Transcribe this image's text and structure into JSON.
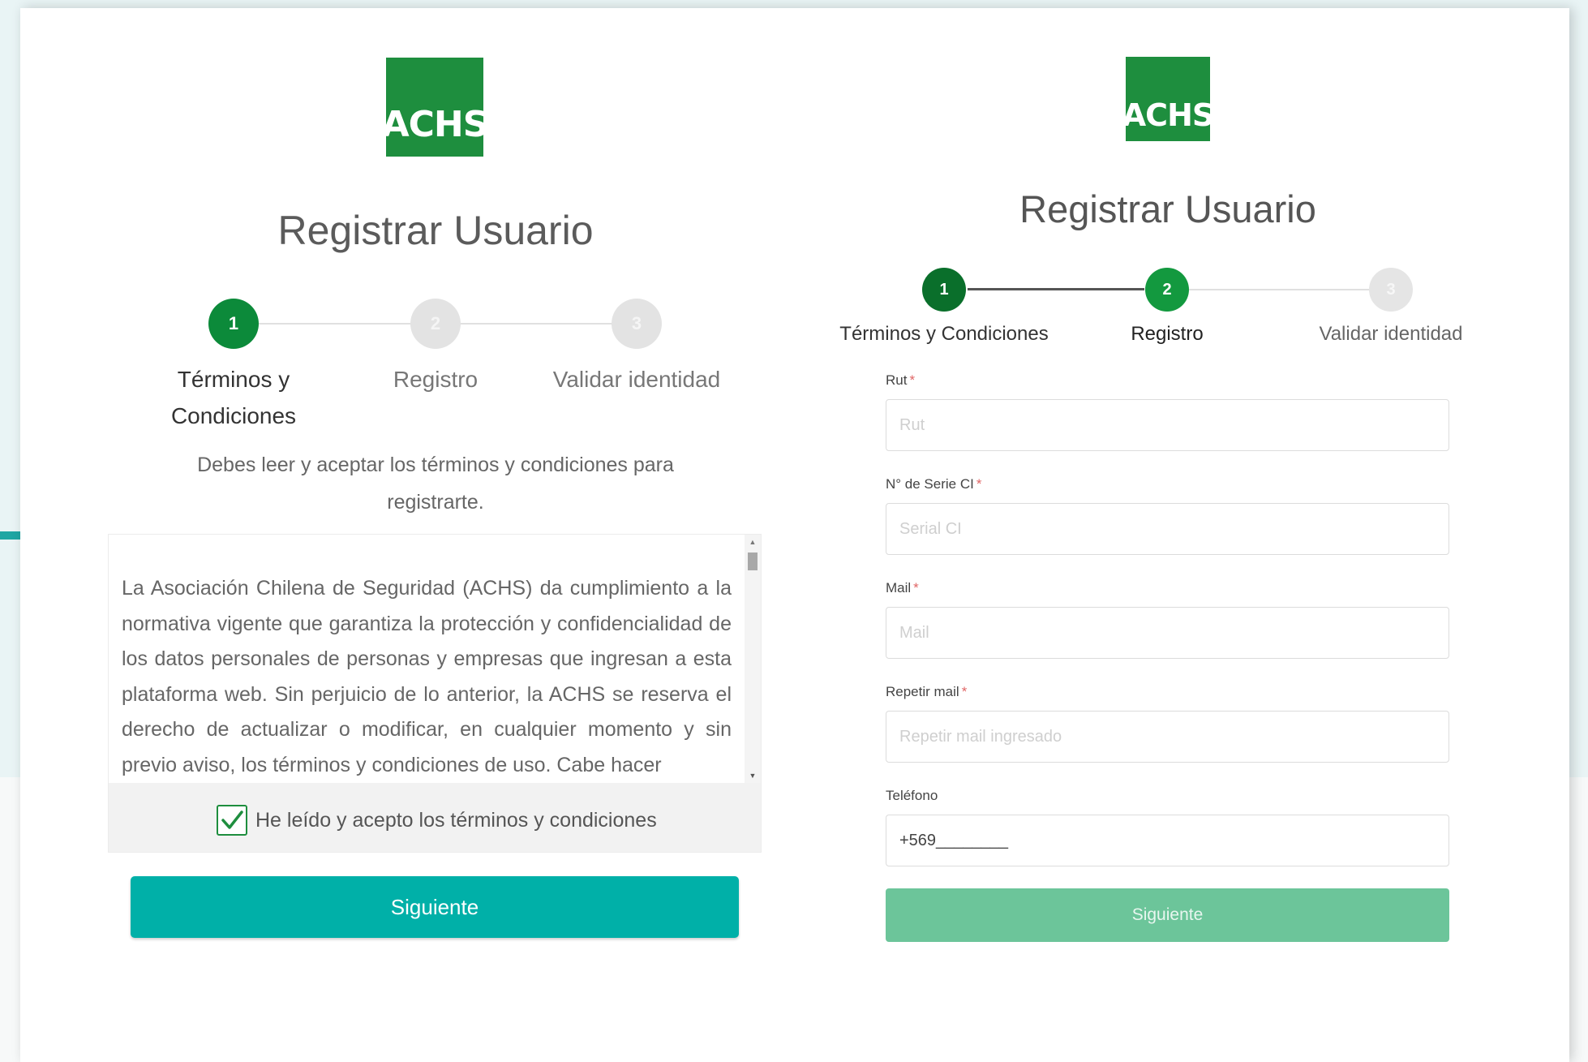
{
  "colors": {
    "brand_green": "#1e8e3e",
    "teal_button": "#00b0a8",
    "disabled_green_button": "#6cc59a",
    "step_active": "#0c8a3a",
    "step_inactive": "#e3e3e3"
  },
  "left": {
    "logo_text": "ACHS",
    "title": "Registrar Usuario",
    "steps": [
      {
        "num": "1",
        "label_line1": "Términos y",
        "label_line2": "Condiciones",
        "state": "active"
      },
      {
        "num": "2",
        "label": "Registro",
        "state": "inactive"
      },
      {
        "num": "3",
        "label": "Validar identidad",
        "state": "inactive"
      }
    ],
    "instruction": "Debes leer y aceptar los términos y condiciones para registrarte.",
    "terms_text": "La Asociación Chilena de Seguridad (ACHS) da cumplimiento a la normativa vigente que garantiza la protección y confidencialidad de los datos personales de personas y empresas que ingresan a esta plataforma web. Sin perjuicio de lo anterior, la ACHS se reserva el derecho de actualizar o modificar, en cualquier momento y sin previo aviso, los términos y condiciones de uso. Cabe hacer",
    "checkbox_label": "He leído y acepto los términos y condiciones",
    "checkbox_checked": true,
    "next_button": "Siguiente",
    "scroll_up_icon": "▲",
    "scroll_down_icon": "▼"
  },
  "right": {
    "logo_text": "ACHS",
    "title": "Registrar Usuario",
    "steps": [
      {
        "num": "1",
        "label": "Términos y Condiciones",
        "state": "done"
      },
      {
        "num": "2",
        "label": "Registro",
        "state": "active"
      },
      {
        "num": "3",
        "label": "Validar identidad",
        "state": "inactive"
      }
    ],
    "fields": [
      {
        "label": "Rut",
        "placeholder": "Rut",
        "value": "",
        "required": "*"
      },
      {
        "label": "N° de Serie CI",
        "placeholder": "Serial CI",
        "value": "",
        "required": "*"
      },
      {
        "label": "Mail",
        "placeholder": "Mail",
        "value": "",
        "required": "*"
      },
      {
        "label": "Repetir mail",
        "placeholder": "Repetir mail ingresado",
        "value": "",
        "required": "*"
      },
      {
        "label": "Teléfono",
        "placeholder": "",
        "value": "+569________"
      }
    ],
    "next_button": "Siguiente"
  }
}
